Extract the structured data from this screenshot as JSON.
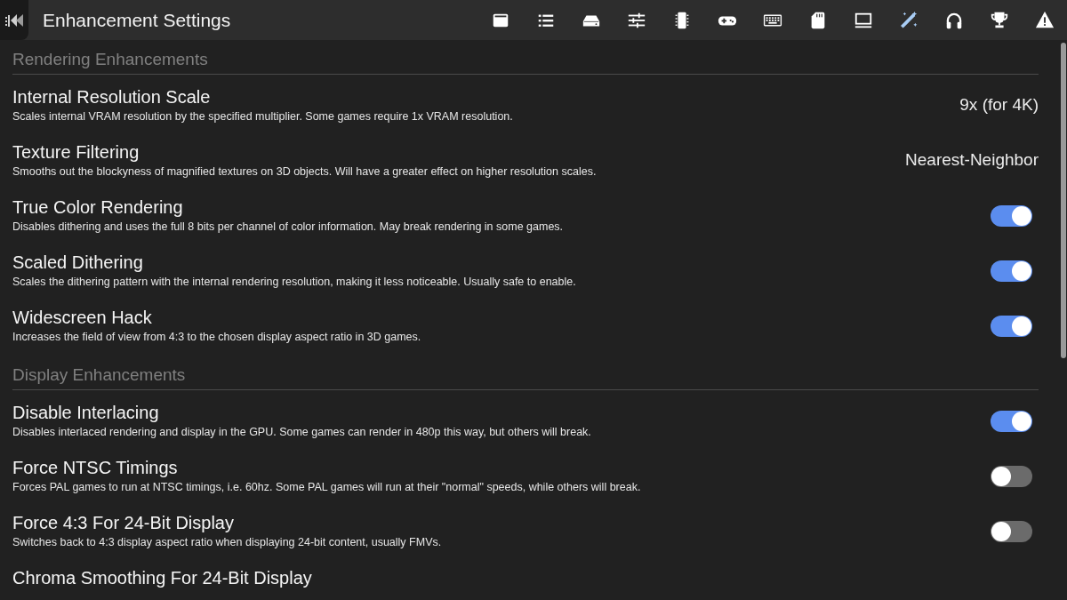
{
  "header": {
    "title": "Enhancement Settings"
  },
  "tabs": [
    {
      "selected": false
    },
    {
      "selected": false
    },
    {
      "selected": false
    },
    {
      "selected": false
    },
    {
      "selected": false
    },
    {
      "selected": false
    },
    {
      "selected": false
    },
    {
      "selected": false
    },
    {
      "selected": false
    },
    {
      "selected": true
    },
    {
      "selected": false
    },
    {
      "selected": false
    },
    {
      "selected": false
    }
  ],
  "sections": [
    {
      "title": "Rendering Enhancements",
      "settings": [
        {
          "kind": "value",
          "name": "Internal Resolution Scale",
          "description": "Scales internal VRAM resolution by the specified multiplier. Some games require 1x VRAM resolution.",
          "value": "9x (for 4K)"
        },
        {
          "kind": "value",
          "name": "Texture Filtering",
          "description": "Smooths out the blockyness of magnified textures on 3D objects. Will have a greater effect on higher resolution scales.",
          "value": "Nearest-Neighbor"
        },
        {
          "kind": "toggle",
          "name": "True Color Rendering",
          "description": "Disables dithering and uses the full 8 bits per channel of color information. May break rendering in some games.",
          "on": true
        },
        {
          "kind": "toggle",
          "name": "Scaled Dithering",
          "description": "Scales the dithering pattern with the internal rendering resolution, making it less noticeable. Usually safe to enable.",
          "on": true
        },
        {
          "kind": "toggle",
          "name": "Widescreen Hack",
          "description": "Increases the field of view from 4:3 to the chosen display aspect ratio in 3D games.",
          "on": true
        }
      ]
    },
    {
      "title": "Display Enhancements",
      "settings": [
        {
          "kind": "toggle",
          "name": "Disable Interlacing",
          "description": "Disables interlaced rendering and display in the GPU. Some games can render in 480p this way, but others will break.",
          "on": true
        },
        {
          "kind": "toggle",
          "name": "Force NTSC Timings",
          "description": "Forces PAL games to run at NTSC timings, i.e. 60hz. Some PAL games will run at their \"normal\" speeds, while others will break.",
          "on": false
        },
        {
          "kind": "toggle",
          "name": "Force 4:3 For 24-Bit Display",
          "description": "Switches back to 4:3 display aspect ratio when displaying 24-bit content, usually FMVs.",
          "on": false
        },
        {
          "kind": "title-only",
          "name": "Chroma Smoothing For 24-Bit Display"
        }
      ]
    }
  ]
}
